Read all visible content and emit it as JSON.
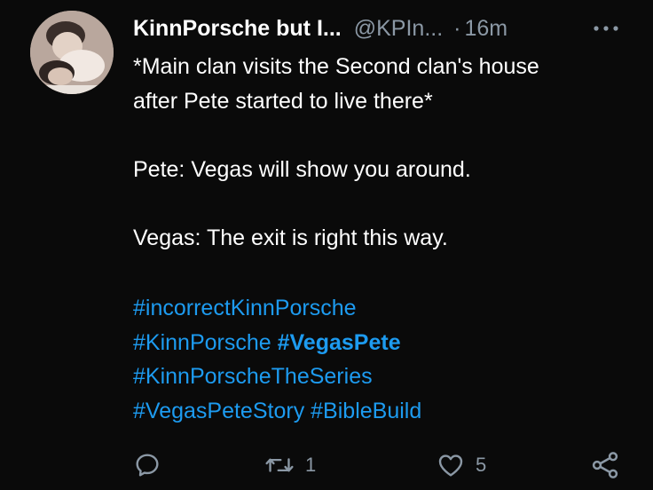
{
  "author": {
    "display_name": "KinnPorsche but I...",
    "handle": "@KPIn...",
    "separator": "·",
    "time": "16m",
    "avatar_icon": "avatar-photo"
  },
  "tweet": {
    "lines": [
      "*Main clan visits the Second clan's house",
      "after Pete started to live there*",
      "Pete: Vegas will show you around.",
      "Vegas: The exit is right this way."
    ],
    "hashtags": [
      "#incorrectKinnPorsche",
      "#KinnPorsche",
      "#VegasPete",
      "#KinnPorscheTheSeries",
      "#VegasPeteStory",
      "#BibleBuild"
    ]
  },
  "actions": {
    "reply": {
      "icon": "reply-icon",
      "count": ""
    },
    "retweet": {
      "icon": "retweet-icon",
      "count": "1"
    },
    "like": {
      "icon": "heart-icon",
      "count": "5"
    },
    "share": {
      "icon": "share-icon"
    }
  },
  "more_icon": "more-icon",
  "colors": {
    "background": "#0a0a0a",
    "text": "#ffffff",
    "secondary": "#8b98a5",
    "hashtag": "#1d9bf0"
  }
}
